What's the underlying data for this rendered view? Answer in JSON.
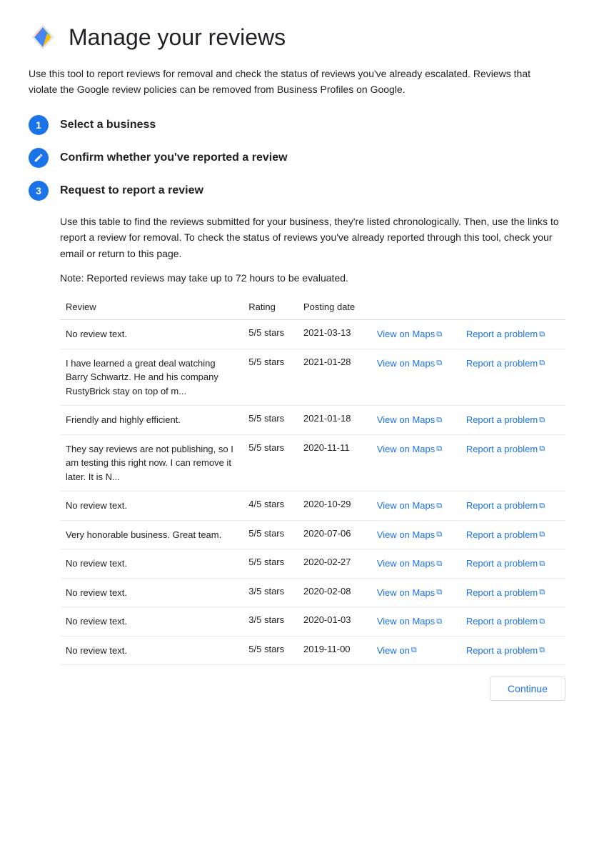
{
  "header": {
    "title": "Manage your reviews",
    "icon_label": "google-maps-icon"
  },
  "description": "Use this tool to report reviews for removal and check the status of reviews you've already escalated. Reviews that violate the Google review policies can be removed from Business Profiles on Google.",
  "steps": [
    {
      "id": 1,
      "type": "number",
      "label": "Select a business"
    },
    {
      "id": 2,
      "type": "pencil",
      "label": "Confirm whether you've reported a review"
    },
    {
      "id": 3,
      "type": "number",
      "label": "Request to report a review"
    }
  ],
  "step3_desc1": "Use this table to find the reviews submitted for your business, they're listed chronologically. Then, use the links to report a review for removal. To check the status of reviews you've already reported through this tool, check your email or return to this page.",
  "step3_note": "Note: Reported reviews may take up to 72 hours to be evaluated.",
  "table": {
    "columns": [
      "Review",
      "Rating",
      "Posting date",
      "",
      ""
    ],
    "rows": [
      {
        "review": "No review text.",
        "rating": "5/5 stars",
        "date": "2021-03-13",
        "view_label": "View on Maps",
        "report_label": "Report a problem"
      },
      {
        "review": "I have learned a great deal watching Barry Schwartz. He and his company RustyBrick stay on top of m...",
        "rating": "5/5 stars",
        "date": "2021-01-28",
        "view_label": "View on Maps",
        "report_label": "Report a problem"
      },
      {
        "review": "Friendly and highly efficient.",
        "rating": "5/5 stars",
        "date": "2021-01-18",
        "view_label": "View on Maps",
        "report_label": "Report a problem"
      },
      {
        "review": "They say reviews are not publishing, so I am testing this right now. I can remove it later. It is N...",
        "rating": "5/5 stars",
        "date": "2020-11-11",
        "view_label": "View on Maps",
        "report_label": "Report a problem"
      },
      {
        "review": "No review text.",
        "rating": "4/5 stars",
        "date": "2020-10-29",
        "view_label": "View on Maps",
        "report_label": "Report a problem"
      },
      {
        "review": "Very honorable business. Great team.",
        "rating": "5/5 stars",
        "date": "2020-07-06",
        "view_label": "View on Maps",
        "report_label": "Report a problem"
      },
      {
        "review": "No review text.",
        "rating": "5/5 stars",
        "date": "2020-02-27",
        "view_label": "View on Maps",
        "report_label": "Report a problem"
      },
      {
        "review": "No review text.",
        "rating": "3/5 stars",
        "date": "2020-02-08",
        "view_label": "View on Maps",
        "report_label": "Report a problem"
      },
      {
        "review": "No review text.",
        "rating": "3/5 stars",
        "date": "2020-01-03",
        "view_label": "View on Maps",
        "report_label": "Report a problem"
      },
      {
        "review": "No review text.",
        "rating": "5/5 stars",
        "date": "2019-11-00",
        "view_label": "View on",
        "report_label": "Report a problem"
      }
    ]
  },
  "continue_button": "Continue"
}
